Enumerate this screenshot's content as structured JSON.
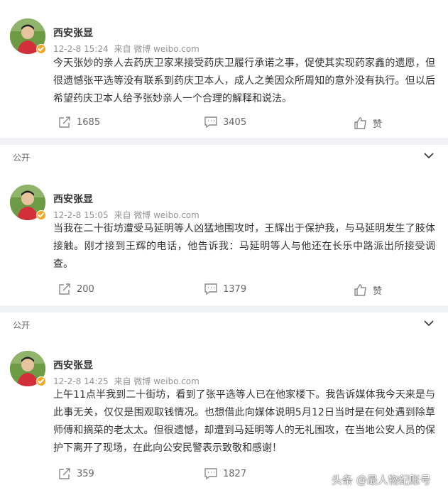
{
  "posts": [
    {
      "author": "西安张显",
      "meta": {
        "time": "12-2-8 15:24",
        "source": "来自 微博 weibo.com"
      },
      "text": "今天张妙的亲人去药庆卫家来接受药庆卫履行承诺之事，促使其实现药家鑫的遗愿，但很遗憾张平选等没有联系到药庆卫本人，成人之美因众所周知的意外没有执行。但以后希望药庆卫本人给予张妙亲人一个合理的解释和说法。",
      "reposts": "1685",
      "comments": "3405",
      "like_label": "赞"
    },
    {
      "visibility": "公开",
      "author": "西安张显",
      "meta": {
        "time": "12-2-8 15:05",
        "source": "来自 微博 weibo.com"
      },
      "text": "当我在二十街坊遭受马延明等人凶猛地围攻时，王辉出于保护我，与马延明发生了肢体接触。刚才接到王辉的电话，他告诉我：马延明等人与他还在长乐中路派出所接受调查。",
      "reposts": "200",
      "comments": "1379",
      "like_label": "赞"
    },
    {
      "visibility": "公开",
      "author": "西安张显",
      "meta": {
        "time": "12-2-8 14:25",
        "source": "来自 微博 weibo.com"
      },
      "text": "上午11点半我到二十街坊，看到了张平选等人已在他家楼下。我告诉媒体我今天来是与此事无关，仅仅是围观取钱情况。也想借此向媒体说明5月12日当时是在何处遇到除草师傅和摘菜的老太太。但很遗憾，却遭到马延明等人的无礼围攻，在当地公安人员的保护下离开了现场，在此向公安民警表示致敬和感谢！",
      "reposts": "359",
      "comments": "1827"
    }
  ],
  "watermark": "头条 @最人物纪账号",
  "colors": {
    "verified_badge": "#f5a623",
    "meta_gray": "#939393",
    "background": "#f1f2f5"
  }
}
